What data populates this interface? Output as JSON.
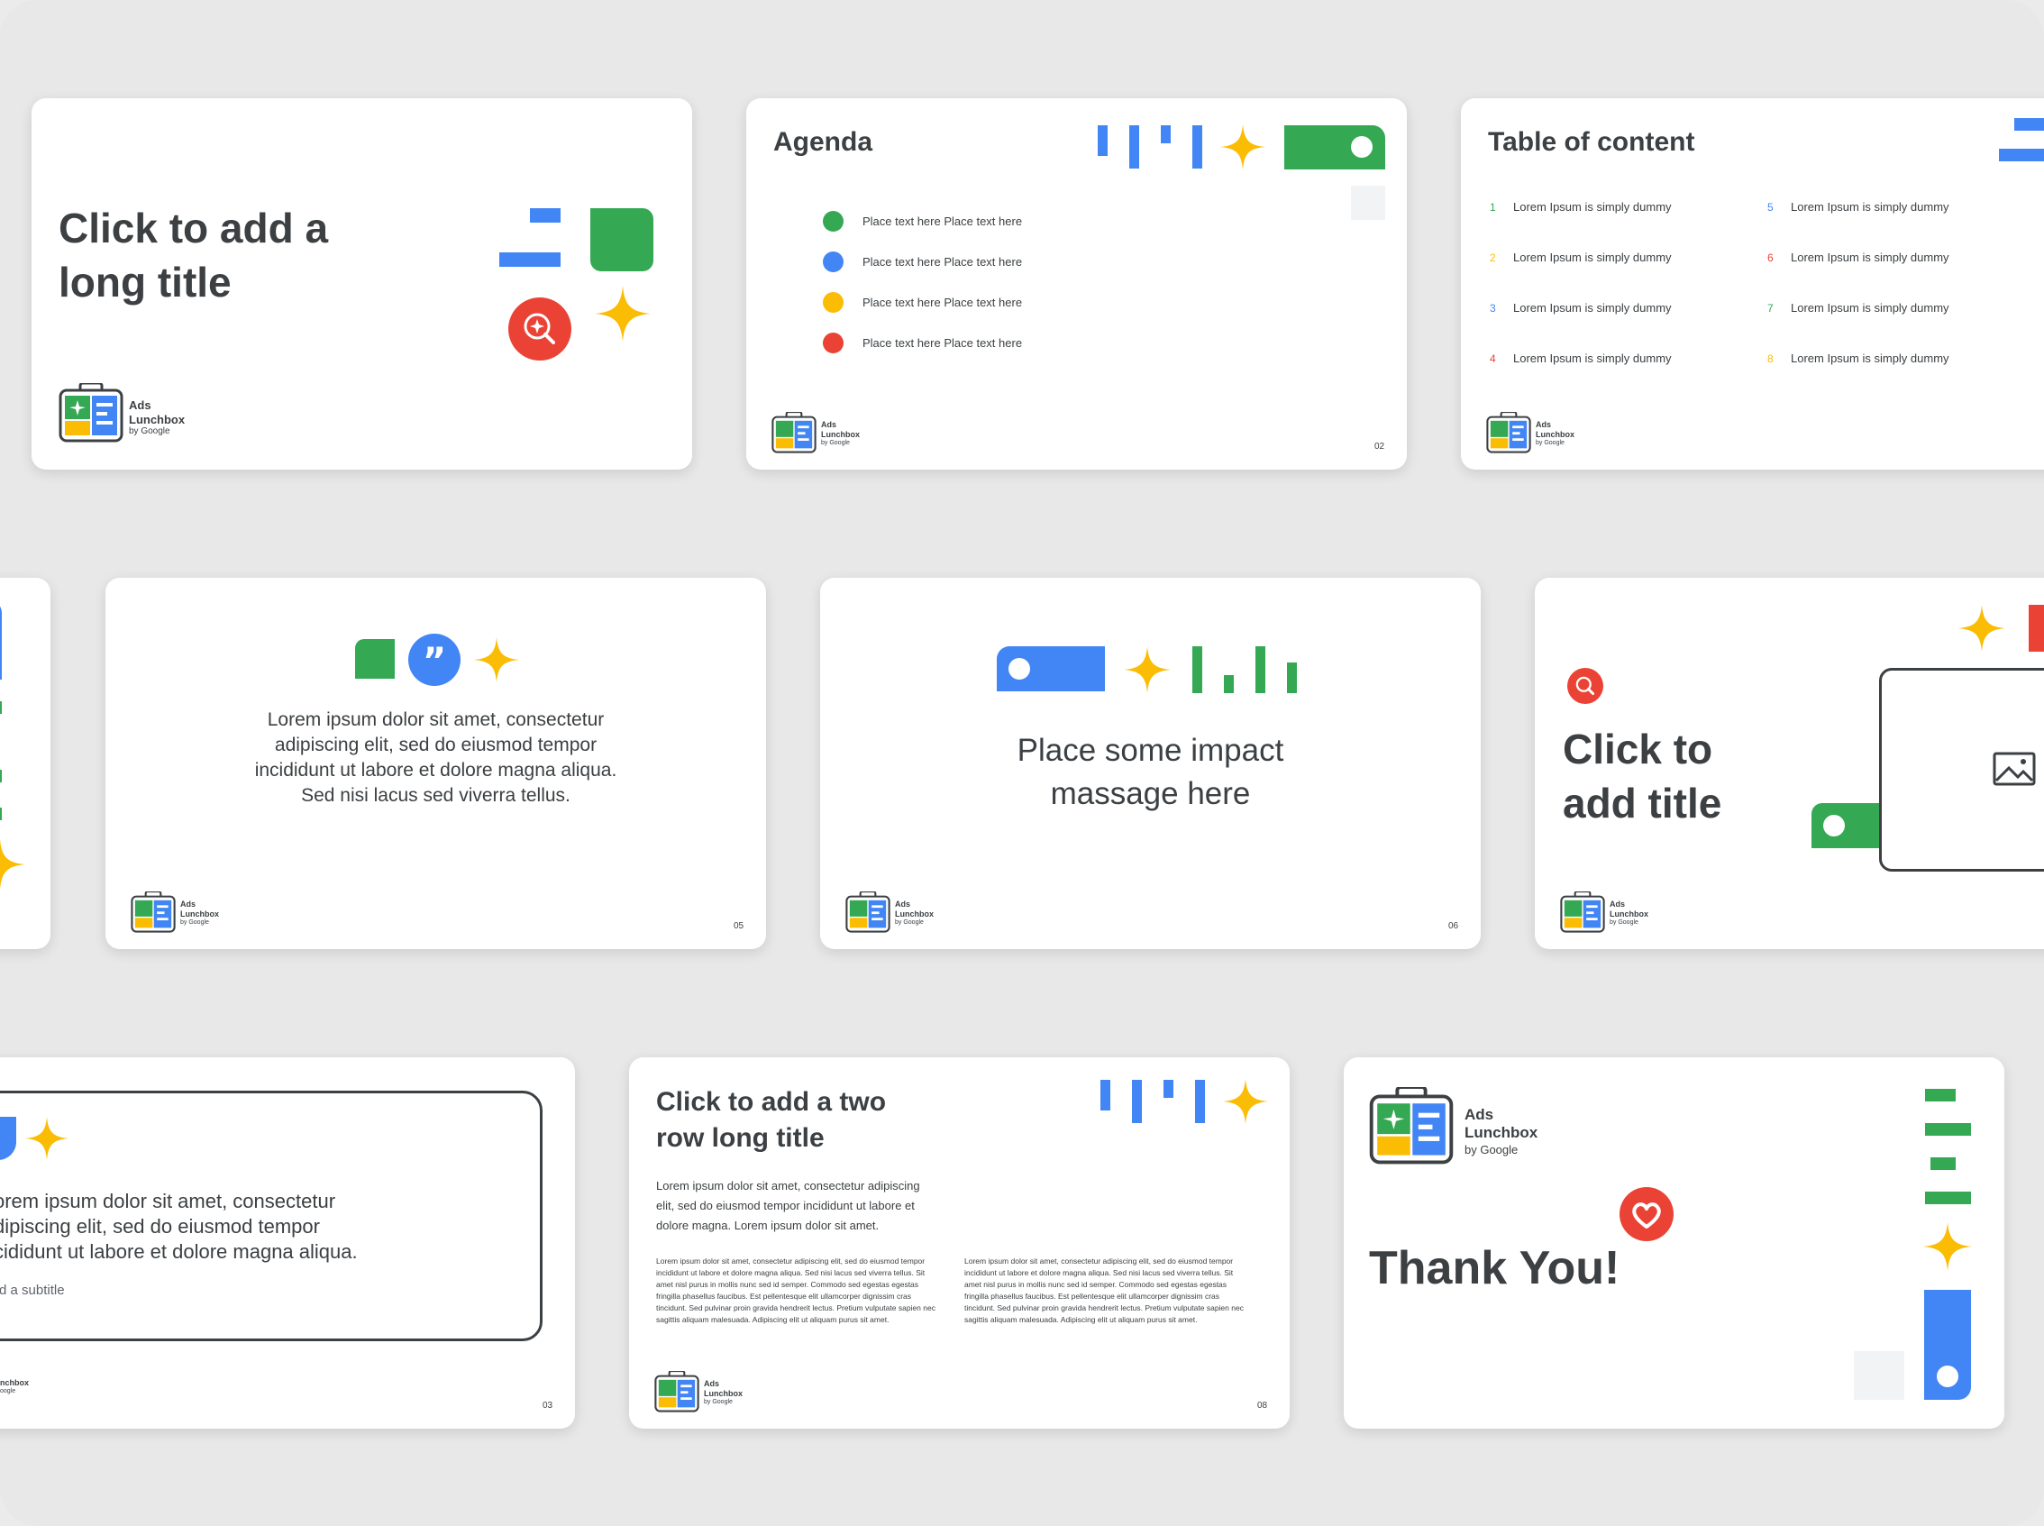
{
  "colors": {
    "blue": "#4285f4",
    "green": "#34a853",
    "yellow": "#fbbc04",
    "red": "#ea4335",
    "text": "#3c4043",
    "bg": "#e8e8e8"
  },
  "brand": {
    "line1": "Ads",
    "line2": "Lunchbox",
    "line3": "by Google"
  },
  "slide1": {
    "title_line1": "Click to add a",
    "title_line2": "long title"
  },
  "slide2": {
    "title": "Agenda",
    "items": [
      "Place text here Place text here",
      "Place text here Place text here",
      "Place text here Place text here",
      "Place text here Place text here"
    ],
    "page": "02"
  },
  "slide3": {
    "title": "Table of content",
    "entries": [
      {
        "num": "1",
        "text": "Lorem Ipsum is simply dummy"
      },
      {
        "num": "2",
        "text": "Lorem Ipsum is simply dummy"
      },
      {
        "num": "3",
        "text": "Lorem Ipsum is simply dummy"
      },
      {
        "num": "4",
        "text": "Lorem Ipsum is simply dummy"
      },
      {
        "num": "5",
        "text": "Lorem Ipsum is simply dummy"
      },
      {
        "num": "6",
        "text": "Lorem Ipsum is simply dummy"
      },
      {
        "num": "7",
        "text": "Lorem Ipsum is simply dummy"
      },
      {
        "num": "8",
        "text": "Lorem Ipsum is simply dummy"
      }
    ]
  },
  "slide5": {
    "quote_lines": [
      "Lorem ipsum dolor sit amet, consectetur",
      "adipiscing elit, sed do eiusmod tempor",
      "incididunt ut labore et dolore magna aliqua.",
      "Sed nisi lacus sed viverra tellus."
    ],
    "page": "05"
  },
  "slide6": {
    "lines": [
      "Place some impact",
      "massage here"
    ],
    "page": "06"
  },
  "slide7": {
    "title_line1": "Click to",
    "title_line2": "add title"
  },
  "slide8": {
    "lines": [
      "orem ipsum dolor sit amet, consectetur",
      "dipiscing elit, sed do eiusmod tempor",
      "cididunt ut labore et dolore magna aliqua."
    ],
    "subtitle": "d a subtitle",
    "logo_line2": "nchbox",
    "logo_line3": "oogle",
    "page": "03"
  },
  "slide9": {
    "title_line1": "Click to add a two",
    "title_line2": "row long title",
    "intro_lines": [
      "Lorem ipsum dolor sit amet, consectetur adipiscing",
      "elit, sed do eiusmod tempor incididunt ut labore et",
      "dolore magna. Lorem ipsum dolor sit amet."
    ],
    "col_lines": [
      "Lorem ipsum dolor sit amet, consectetur adipiscing elit, sed do eiusmod tempor",
      "incididunt ut labore et dolore magna aliqua. Sed nisi lacus sed viverra tellus. Sit",
      "amet nisl purus in mollis nunc sed id semper. Commodo sed egestas egestas",
      "fringilla phasellus faucibus. Est pellentesque elit ullamcorper dignissim cras",
      "tincidunt. Sed pulvinar proin gravida hendrerit lectus. Pretium vulputate sapien nec",
      "sagittis aliquam malesuada. Adipiscing elit ut aliquam purus sit amet."
    ],
    "page": "08"
  },
  "slide10": {
    "title": "Thank You!"
  }
}
